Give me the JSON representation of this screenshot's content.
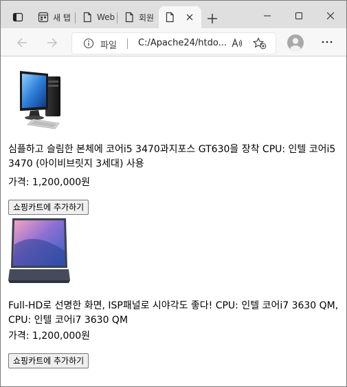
{
  "tabs": [
    {
      "label": "새 탭",
      "icon": "new-tab-page-icon"
    },
    {
      "label": "Web",
      "icon": "page-icon"
    },
    {
      "label": "회원",
      "icon": "page-icon"
    },
    {
      "label": "",
      "icon": "page-icon",
      "active": true
    }
  ],
  "address": {
    "scheme": "파일",
    "url": "C:/Apache24/htdo..."
  },
  "products": [
    {
      "image": "desktop-pc-image",
      "description": "심플하고 슬림한 본체에 코어i5 3470과지포스 GT630을 장착 CPU: 인텔 코어i5 3470 (아이비브릿지 3세대) 사용",
      "price": "가격: 1,200,000원",
      "cart_button": "쇼핑카트에 추가하기"
    },
    {
      "image": "laptop-image",
      "description": "Full-HD로 선명한 화면, ISP패널로 시야각도 좋다! CPU: 인텔 코어i7 3630 QM, CPU: 인텔 코어i7 3630 QM",
      "price": "가격: 1,200,000원",
      "cart_button": "쇼핑카트에 추가하기"
    }
  ]
}
